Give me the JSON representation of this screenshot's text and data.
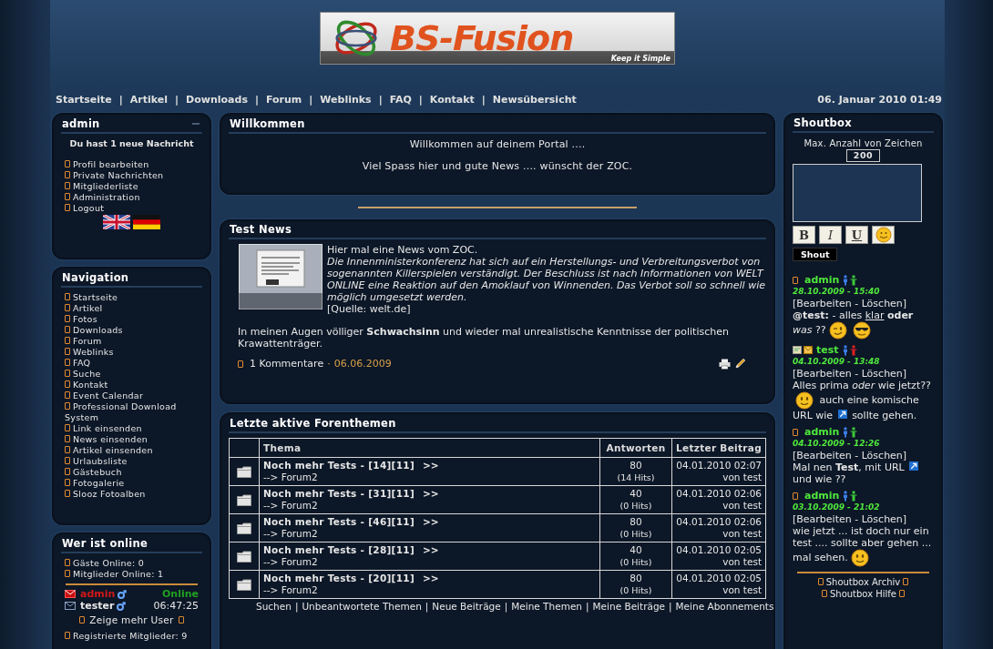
{
  "header": {
    "logo": {
      "title": "BS-Fusion",
      "tagline": "Keep it Simple"
    },
    "nav": {
      "separator": "|",
      "items": [
        "Startseite",
        "Artikel",
        "Downloads",
        "Forum",
        "Weblinks",
        "FAQ",
        "Kontakt",
        "Newsübersicht"
      ]
    },
    "datetime": "06. Januar 2010 01:49"
  },
  "user_panel": {
    "title": "admin",
    "message": "Du hast 1 neue Nachricht",
    "links": [
      "Profil bearbeiten",
      "Private Nachrichten",
      "Mitgliederliste",
      "Administration",
      "Logout"
    ]
  },
  "navigation": {
    "title": "Navigation",
    "items": [
      "Startseite",
      "Artikel",
      "Fotos",
      "Downloads",
      "Forum",
      "Weblinks",
      "FAQ",
      "Suche",
      "Kontakt",
      "Event Calendar",
      "Professional Download System",
      "Link einsenden",
      "News einsenden",
      "Artikel einsenden",
      "Urlaubsliste",
      "Gästebuch",
      "Fotogalerie",
      "Slooz Fotoalben"
    ]
  },
  "online": {
    "title": "Wer ist online",
    "stats": [
      "Gäste Online: 0",
      "Mitglieder Online: 1"
    ],
    "users": [
      {
        "name": "admin",
        "color": "#d01818",
        "unread": true,
        "status": "Online",
        "online": true
      },
      {
        "name": "tester",
        "color": "#e6e6e6",
        "unread": false,
        "status": "06:47:25",
        "online": false
      }
    ],
    "more": "Zeige mehr User",
    "registered": "Registrierte Mitglieder: 9"
  },
  "welcome": {
    "title": "Willkommen",
    "lines": [
      "Willkommen auf deinem Portal ....",
      "Viel Spass hier und gute News .... wünscht der ZOC."
    ]
  },
  "news": {
    "title": "Test News",
    "intro": "Hier mal eine News vom ZOC.",
    "quote": "Die Innenministerkonferenz hat sich auf ein Herstellungs- und Verbreitungsverbot von sogenannten Killerspielen verständigt. Der Beschluss ist nach Informationen von WELT ONLINE eine Reaktion auf den Amoklauf von Winnenden. Das Verbot soll so schnell wie möglich umgesetzt werden.",
    "source": "[Quelle: welt.de]",
    "comment": "In meinen Augen völliger **Schwachsinn** und wieder mal unrealistische Kenntnisse der politischen Krawattenträger.",
    "comments": "1 Kommentare",
    "dot": "·",
    "date": "06.06.2009"
  },
  "forum": {
    "title": "Letzte aktive Forenthemen",
    "columns": [
      "Thema",
      "Antworten",
      "Letzter Beitrag"
    ],
    "rows": [
      {
        "title": "Noch mehr Tests - [14][11]",
        "arrow": ">>",
        "forum": "--> Forum2",
        "replies": "80",
        "hits": "(14 Hits)",
        "date": "04.01.2010 02:07",
        "by": "von test"
      },
      {
        "title": "Noch mehr Tests - [31][11]",
        "arrow": ">>",
        "forum": "--> Forum2",
        "replies": "40",
        "hits": "(0 Hits)",
        "date": "04.01.2010 02:06",
        "by": "von test"
      },
      {
        "title": "Noch mehr Tests - [46][11]",
        "arrow": ">>",
        "forum": "--> Forum2",
        "replies": "80",
        "hits": "(0 Hits)",
        "date": "04.01.2010 02:06",
        "by": "von test"
      },
      {
        "title": "Noch mehr Tests - [28][11]",
        "arrow": ">>",
        "forum": "--> Forum2",
        "replies": "40",
        "hits": "(0 Hits)",
        "date": "04.01.2010 02:05",
        "by": "von test"
      },
      {
        "title": "Noch mehr Tests - [20][11]",
        "arrow": ">>",
        "forum": "--> Forum2",
        "replies": "80",
        "hits": "(0 Hits)",
        "date": "04.01.2010 02:05",
        "by": "von test"
      }
    ],
    "separator": "|",
    "links": [
      "Suchen",
      "Unbeantwortete Themen",
      "Neue Beiträge",
      "Meine Themen",
      "Meine Beiträge",
      "Meine Abonnements"
    ]
  },
  "shoutbox": {
    "title": "Shoutbox",
    "max_label": "Max. Anzahl von Zeichen",
    "max": "200",
    "format_buttons": [
      {
        "label": "B",
        "kind": "bold"
      },
      {
        "label": "I",
        "kind": "italic"
      },
      {
        "label": "U",
        "kind": "underline"
      }
    ],
    "shout": "Shout",
    "shouts": [
      {
        "contact_icons": false,
        "user": "admin",
        "online": true,
        "date": "28.10.2009 - 15:40",
        "actions": "[Bearbeiten - Löschen]",
        "parts": [
          {
            "kind": "text",
            "text": "**@test:** - alles "
          },
          {
            "kind": "underlined",
            "text": "klar"
          },
          {
            "kind": "text",
            "text": " **oder** *was* ??"
          },
          {
            "kind": "wink"
          },
          {
            "kind": "cool"
          }
        ]
      },
      {
        "contact_icons": true,
        "user": "test",
        "online": false,
        "date": "04.10.2009 - 13:48",
        "actions": "[Bearbeiten - Löschen]",
        "parts": [
          {
            "kind": "text",
            "text": "Alles prima *oder* wie jetzt??"
          },
          {
            "kind": "smile"
          },
          {
            "kind": "text",
            "text": " auch eine komische URL wie "
          },
          {
            "kind": "link"
          },
          {
            "kind": "text",
            "text": " sollte gehen."
          }
        ]
      },
      {
        "contact_icons": false,
        "user": "admin",
        "online": true,
        "date": "04.10.2009 - 12:26",
        "actions": "[Bearbeiten - Löschen]",
        "parts": [
          {
            "kind": "text",
            "text": "Mal nen **Test**, mit URL "
          },
          {
            "kind": "link"
          },
          {
            "kind": "text",
            "text": " und wie ??"
          }
        ]
      },
      {
        "contact_icons": false,
        "user": "admin",
        "online": true,
        "date": "03.10.2009 - 21:02",
        "actions": "[Bearbeiten - Löschen]",
        "parts": [
          {
            "kind": "text",
            "text": "wie jetzt ... ist doch nur ein test .... sollte aber gehen ... mal sehen."
          },
          {
            "kind": "smile"
          }
        ]
      }
    ],
    "footer_links": [
      "Shoutbox Archiv",
      "Shoutbox Hilfe"
    ]
  }
}
